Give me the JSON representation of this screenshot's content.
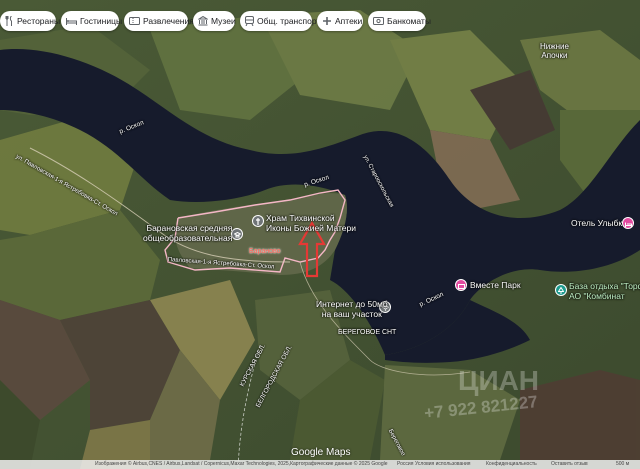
{
  "chips": [
    {
      "label": "Рестораны",
      "icon": "fork-knife-icon"
    },
    {
      "label": "Гостиницы",
      "icon": "bed-icon"
    },
    {
      "label": "Развлечения",
      "icon": "ticket-icon"
    },
    {
      "label": "Музеи",
      "icon": "museum-icon"
    },
    {
      "label": "Общ. транспорт",
      "icon": "transit-icon"
    },
    {
      "label": "Аптеки",
      "icon": "pharmacy-icon"
    },
    {
      "label": "Банкоматы",
      "icon": "atm-icon"
    }
  ],
  "places": {
    "nizhnie": "Нижние\nАпочки",
    "oskol_1": "р. Оскол",
    "oskol_2": "р. Оскол",
    "oskol_3": "р. Оскол",
    "staroskol": "ул. Старооскольская",
    "hram": "Храм Тихвинской\nИконы Божией Матери",
    "school": "Барановская средняя\nобщеобразовательная",
    "baranovo": "Бараново",
    "street_left": "ул. Павловская-1-я Ястребовка-Ст. Оскол",
    "street_mid": "Павловская-1-я Ястребовка-Ст. Оскол",
    "internet": "Интернет до 50мб\nна ваш участок",
    "beregovoe": "БЕРЕГОВОЕ СНТ",
    "kursk": "КУРСКАЯ ОБЛ.",
    "belgorod": "БЕЛГОРОДСКАЯ ОБЛ.",
    "bottom_road": "Береговое",
    "ulybka": "Отель Улыбка",
    "vmeste": "Вместе Парк",
    "baza": "База отдыха \"Торфян\nАО \"Комбинат"
  },
  "logo": "Google Maps",
  "attribution": {
    "text": "Изображения © Airbus,CNES / Airbus,Landsat / Copernicus,Maxar Technologies, 2025,Картографические данные © 2025 Google",
    "country": "Россия",
    "terms": "Условия использования",
    "privacy": "Конфиденциальность",
    "feedback": "Оставить отзыв",
    "scale": "500 м"
  },
  "watermark": {
    "brand": "ЦИАН",
    "phone": "+7 922 821227"
  }
}
